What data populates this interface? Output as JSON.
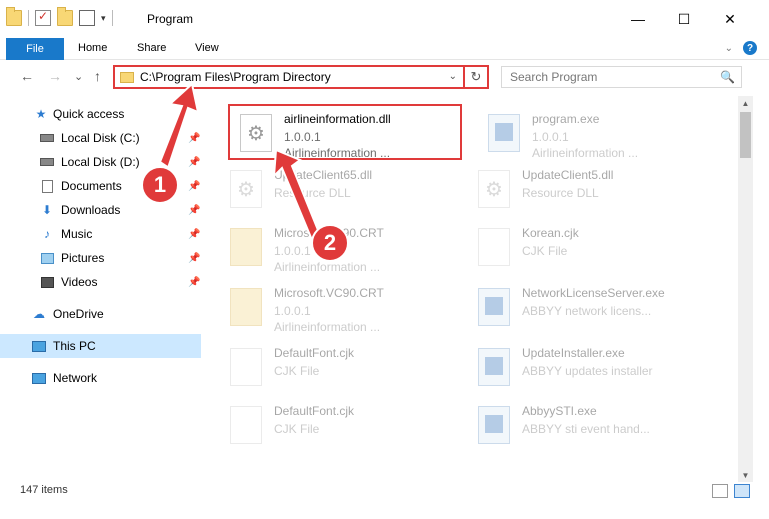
{
  "window": {
    "title": "Program",
    "minimize": "—",
    "maximize": "☐",
    "close": "✕"
  },
  "ribbon": {
    "file": "File",
    "home": "Home",
    "share": "Share",
    "view": "View",
    "expand_icon": "chevron-down-icon",
    "help": "?"
  },
  "nav": {
    "back": "←",
    "forward": "→",
    "recent": "⌄",
    "up": "↑",
    "address": "C:\\Program Files\\Program Directory",
    "address_drop": "⌄",
    "refresh": "↻",
    "search_placeholder": "Search Program",
    "search_glyph": "🔍"
  },
  "sidebar": {
    "items": [
      {
        "label": "Quick access",
        "icon": "star-icon",
        "glyph": "★"
      },
      {
        "label": "Local Disk (C:)",
        "icon": "drive-icon",
        "pinned": true
      },
      {
        "label": "Local Disk (D:)",
        "icon": "drive-icon",
        "pinned": true
      },
      {
        "label": "Documents",
        "icon": "documents-icon",
        "pinned": true
      },
      {
        "label": "Downloads",
        "icon": "download-icon",
        "glyph": "⬇",
        "pinned": true
      },
      {
        "label": "Music",
        "icon": "music-icon",
        "glyph": "♪",
        "pinned": true
      },
      {
        "label": "Pictures",
        "icon": "pictures-icon",
        "pinned": true
      },
      {
        "label": "Videos",
        "icon": "videos-icon",
        "pinned": true
      },
      {
        "label": "OneDrive",
        "icon": "cloud-icon",
        "glyph": "☁"
      },
      {
        "label": "This PC",
        "icon": "computer-icon",
        "selected": true
      },
      {
        "label": "Network",
        "icon": "network-icon"
      }
    ],
    "pin_glyph": "📌"
  },
  "files": [
    {
      "name": "airlineinformation.dll",
      "line1": "1.0.0.1",
      "line2": "Airlineinformation ...",
      "icon": "gear",
      "highlighted": true
    },
    {
      "name": "program.exe",
      "line1": "1.0.0.1",
      "line2": "Airlineinformation ...",
      "icon": "app",
      "faded": true
    },
    {
      "name": "UpdateClient65.dll",
      "line1": "Resource DLL",
      "line2": "",
      "icon": "gear",
      "faded": true
    },
    {
      "name": "UpdateClient5.dll",
      "line1": "Resource DLL",
      "line2": "",
      "icon": "gear",
      "faded": true
    },
    {
      "name": "Microsoft.VC90.CRT",
      "line1": "1.0.0.1",
      "line2": "Airlineinformation ...",
      "icon": "folderish",
      "faded": true
    },
    {
      "name": "Korean.cjk",
      "line1": "CJK File",
      "line2": "",
      "icon": "plain",
      "faded": true
    },
    {
      "name": "Microsoft.VC90.CRT",
      "line1": "1.0.0.1",
      "line2": "Airlineinformation ...",
      "icon": "folderish",
      "faded": true
    },
    {
      "name": "NetworkLicenseServer.exe",
      "line1": "ABBYY network licens...",
      "line2": "",
      "icon": "app",
      "faded": true
    },
    {
      "name": "DefaultFont.cjk",
      "line1": "CJK File",
      "line2": "",
      "icon": "plain",
      "faded": true
    },
    {
      "name": "UpdateInstaller.exe",
      "line1": "ABBYY updates installer",
      "line2": "",
      "icon": "app",
      "faded": true
    },
    {
      "name": "DefaultFont.cjk",
      "line1": "CJK File",
      "line2": "",
      "icon": "plain",
      "faded": true
    },
    {
      "name": "AbbyySTI.exe",
      "line1": "ABBYY sti event hand...",
      "line2": "",
      "icon": "app",
      "faded": true
    }
  ],
  "status": {
    "count": "147 items"
  },
  "annotations": {
    "badge1": "1",
    "badge2": "2",
    "color": "#e03a3a"
  }
}
